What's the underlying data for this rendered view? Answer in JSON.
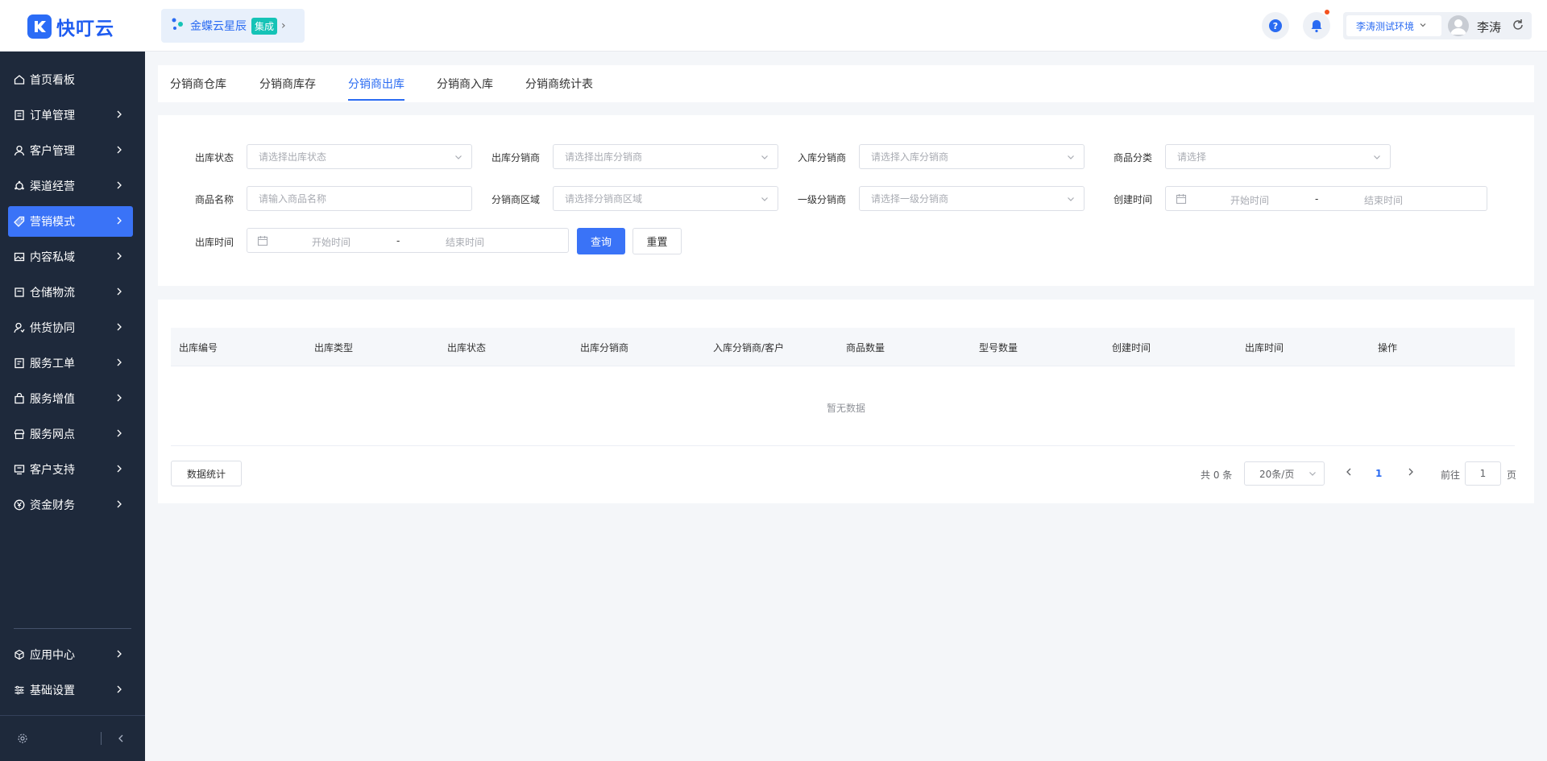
{
  "header": {
    "logo_text": "快叮云",
    "brand": {
      "name": "金蝶云星辰",
      "tag": "集成"
    },
    "environment": "李涛测试环境",
    "user_name": "李涛"
  },
  "sidebar": {
    "items": [
      {
        "label": "首页看板",
        "icon": "home-icon"
      },
      {
        "label": "订单管理",
        "icon": "order-icon"
      },
      {
        "label": "客户管理",
        "icon": "user-icon"
      },
      {
        "label": "渠道经营",
        "icon": "channel-icon"
      },
      {
        "label": "营销模式",
        "icon": "tag-icon",
        "active": true
      },
      {
        "label": "内容私域",
        "icon": "image-icon"
      },
      {
        "label": "仓储物流",
        "icon": "warehouse-icon"
      },
      {
        "label": "供货协同",
        "icon": "supply-icon"
      },
      {
        "label": "服务工单",
        "icon": "ticket-icon"
      },
      {
        "label": "服务增值",
        "icon": "bag-icon"
      },
      {
        "label": "服务网点",
        "icon": "store-icon"
      },
      {
        "label": "客户支持",
        "icon": "support-icon"
      },
      {
        "label": "资金财务",
        "icon": "yen-icon"
      }
    ],
    "bottom_items": [
      {
        "label": "应用中心",
        "icon": "cube-icon"
      },
      {
        "label": "基础设置",
        "icon": "settings-icon"
      }
    ]
  },
  "tabs": [
    {
      "label": "分销商仓库"
    },
    {
      "label": "分销商库存"
    },
    {
      "label": "分销商出库",
      "active": true
    },
    {
      "label": "分销商入库"
    },
    {
      "label": "分销商统计表"
    }
  ],
  "filters": {
    "out_status": {
      "label": "出库状态",
      "placeholder": "请选择出库状态"
    },
    "out_distributor": {
      "label": "出库分销商",
      "placeholder": "请选择出库分销商"
    },
    "in_distributor": {
      "label": "入库分销商",
      "placeholder": "请选择入库分销商"
    },
    "category": {
      "label": "商品分类",
      "placeholder": "请选择"
    },
    "product_name": {
      "label": "商品名称",
      "placeholder": "请输入商品名称"
    },
    "region": {
      "label": "分销商区域",
      "placeholder": "请选择分销商区域"
    },
    "level1": {
      "label": "一级分销商",
      "placeholder": "请选择一级分销商"
    },
    "created": {
      "label": "创建时间",
      "start": "开始时间",
      "sep": "-",
      "end": "结束时间"
    },
    "out_time": {
      "label": "出库时间",
      "start": "开始时间",
      "sep": "-",
      "end": "结束时间"
    },
    "query_label": "查询",
    "reset_label": "重置"
  },
  "table": {
    "columns": [
      "出库编号",
      "出库类型",
      "出库状态",
      "出库分销商",
      "入库分销商/客户",
      "商品数量",
      "型号数量",
      "创建时间",
      "出库时间",
      "操作"
    ],
    "empty_text": "暂无数据",
    "stats_button": "数据统计"
  },
  "pagination": {
    "total": "共 0 条",
    "page_size": "20条/页",
    "current_page": "1",
    "goto_label": "前往",
    "goto_value": "1",
    "page_suffix": "页"
  },
  "colors": {
    "primary": "#3a73f7",
    "sidebar_bg": "#1e293b",
    "page_bg": "#f4f6f9"
  }
}
